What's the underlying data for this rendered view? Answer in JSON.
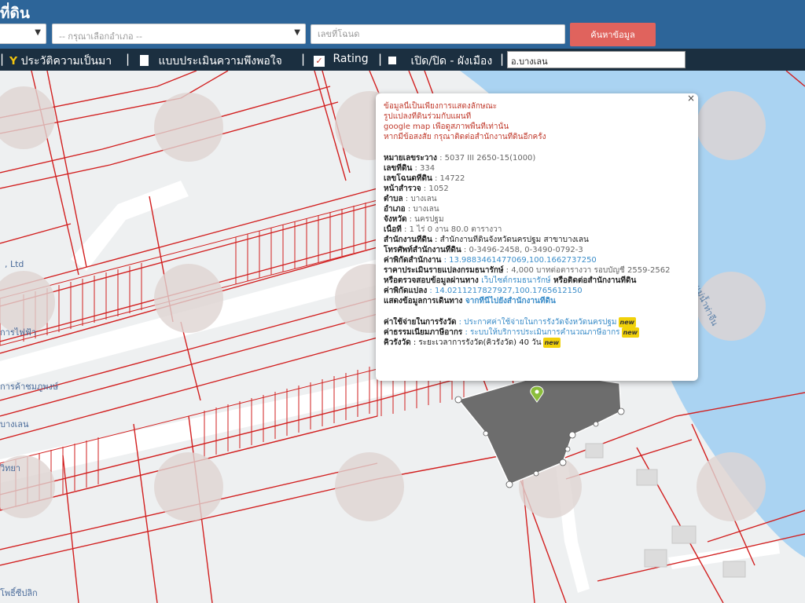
{
  "header": {
    "title": "ที่ดิน",
    "district_placeholder": "",
    "amphoe_placeholder": "-- กรุณาเลือกอำเภอ --",
    "deed_placeholder": "เลขที่โฉนด",
    "search_label": "ค้นหาข้อมูล"
  },
  "toolbar": {
    "history_label": "ประวัติความเป็นมา",
    "survey_label": "แบบประเมินความพึงพอใจ",
    "rating_label": "Rating",
    "toggle_label": "เปิด/ปิด - ผังเมือง",
    "town_value": "อ.บางเลน",
    "separator": "|"
  },
  "map": {
    "labels": {
      "ltd": ", Ltd",
      "road1": "การไฟฟ้า",
      "road2": "การค้าชมภูพงษ์",
      "road3": "บางเลน",
      "road4": "วิทยา",
      "road5": "โพธิ์ซีปลิก",
      "river": "แม่น้ำท่าจีน"
    },
    "colors": {
      "water": "#aad3f2",
      "land": "#eef0f1",
      "parcel_line": "#d21f1f",
      "road": "#ffffff",
      "highlight": "#6d6d6d"
    }
  },
  "popup": {
    "close": "×",
    "notice": [
      "ข้อมูลนี้เป็นเพียงการแสดงลักษณะ",
      "รูปแปลงที่ดินร่วมกับแผนที่",
      "google map เพื่อดูสภาพพื้นที่เท่านั้น",
      "หากมีข้อสงสัย กรุณาติดต่อสำนักงานที่ดินอีกครั้ง"
    ],
    "fields": [
      {
        "label": "หมายเลขระวาง",
        "value": " : 5037 III 2650-15(1000)"
      },
      {
        "label": "เลขที่ดิน",
        "value": " : 334"
      },
      {
        "label": "เลขโฉนดที่ดิน",
        "value": " : 14722"
      },
      {
        "label": "หน้าสำรวจ",
        "value": " : 1052"
      },
      {
        "label": "ตำบล",
        "value": " : บางเลน"
      },
      {
        "label": "อำเภอ",
        "value": " : บางเลน"
      },
      {
        "label": "จังหวัด",
        "value": " : นครปฐม"
      },
      {
        "label": "เนื้อที่",
        "value": " : 1 ไร่ 0 งาน 80.0 ตารางวา"
      },
      {
        "label": "สำนักงานที่ดิน",
        "value": " : สำนักงานที่ดินจังหวัดนครปฐม สาขาบางเลน"
      },
      {
        "label": "โทรศัพท์สำนักงานที่ดิน",
        "value": " : 0-3496-2458, 0-3490-0792-3"
      }
    ],
    "office_coord_label": "ค่าพิกัดสำนักงาน",
    "office_coord_value": " : 13.9883461477069,100.1662737250",
    "price_label": "ราคาประเมินรายแปลงกรมธนารักษ์",
    "price_value": " : 4,000 บาทต่อตารางวา รอบบัญชี 2559-2562",
    "check_prefix": "หรือตรวจสอบข้อมูลผ่านทาง ",
    "check_link": "เว็บไซต์กรมธนารักษ์",
    "check_suffix": " หรือติดต่อสำนักงานที่ดิน",
    "parcel_coord_label": "ค่าพิกัดแปลง",
    "parcel_coord_value": " : 14.0211217827927,100.1765612150",
    "route_label": "แสดงข้อมูลการเดินทาง",
    "route_link": " จากที่นี่ไปยังสำนักงานที่ดิน",
    "survey_cost_label": "ค่าใช้จ่ายในการรังวัด",
    "survey_cost_link": " : ประกาศค่าใช้จ่ายในการรังวัดจังหวัดนครปฐม",
    "tax_label": "ค่าธรรมเนียมภาษีอากร",
    "tax_link": " : ระบบให้บริการประเมินการคำนวณภาษีอากร",
    "queue_label": "คิวรังวัด",
    "queue_value": " : ระยะเวลาการรังวัด(คิวรังวัด) 40 วัน",
    "badge": "new"
  }
}
